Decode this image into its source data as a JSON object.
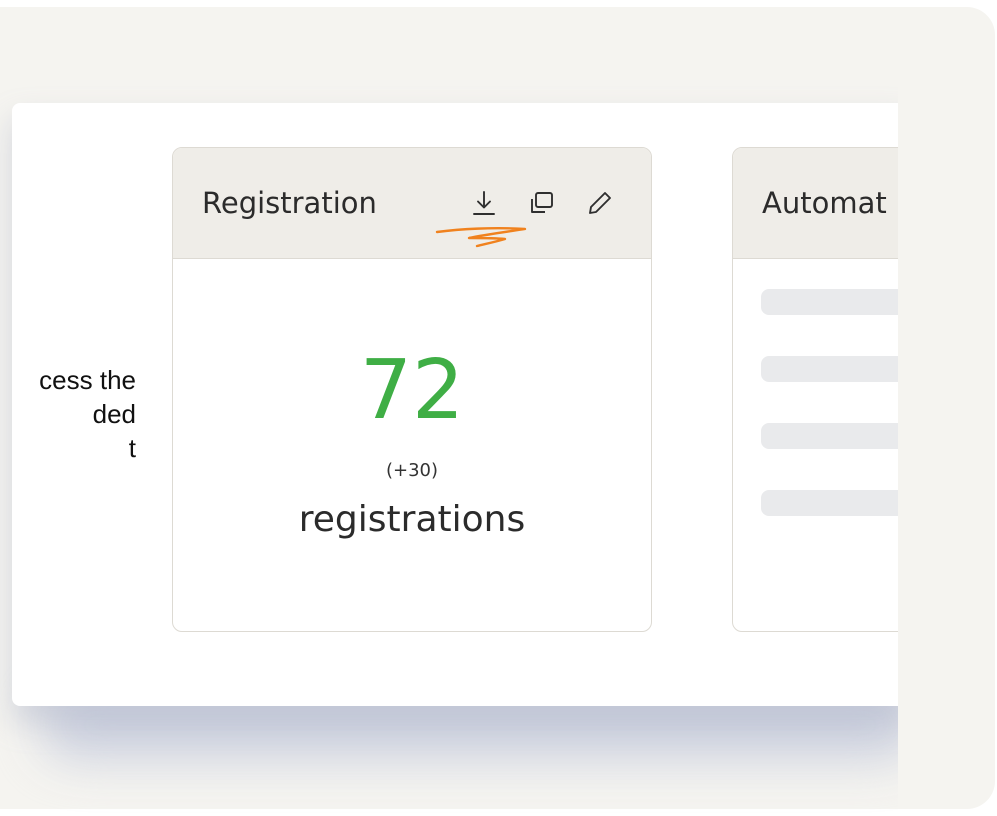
{
  "side_text": {
    "line1": "cess the",
    "line2": "ded",
    "line3": "t"
  },
  "registration_card": {
    "title": "Registration",
    "value": "72",
    "delta": "(+30)",
    "label": "registrations",
    "icons": [
      "download-icon",
      "copy-icon",
      "edit-icon"
    ]
  },
  "automation_card": {
    "title": "Automat",
    "placeholder_rows": 4
  },
  "colors": {
    "metric": "#3fae45",
    "highlight": "#f0821e",
    "header_bg": "#efede8",
    "backdrop": "#f5f4f0"
  }
}
